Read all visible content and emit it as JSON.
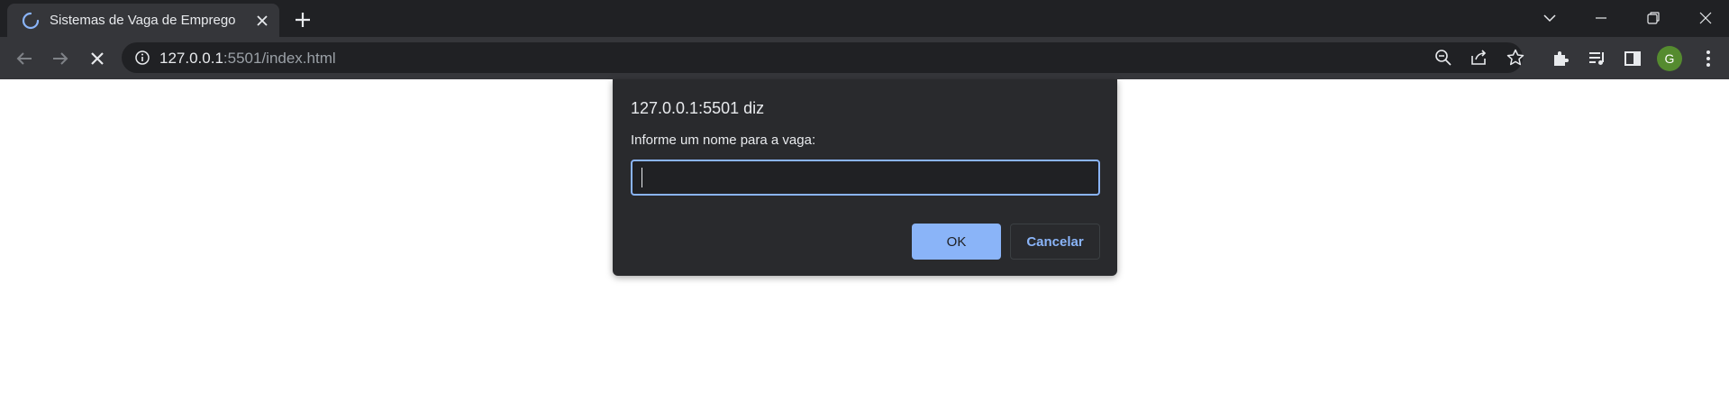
{
  "browser": {
    "tab": {
      "title": "Sistemas de Vaga de Emprego",
      "loading_icon": "spinner-icon",
      "close_icon": "close-icon"
    },
    "new_tab_icon": "plus-icon",
    "window_controls": [
      "tab-search-icon",
      "minimize-icon",
      "restore-icon",
      "close-icon"
    ],
    "toolbar": {
      "back_icon": "back-arrow-icon",
      "forward_icon": "forward-arrow-icon",
      "stop_icon": "stop-icon",
      "url_host": "127.0.0.1",
      "url_rest": ":5501/index.html",
      "omnibox_icons": [
        "zoom-out-icon",
        "share-icon",
        "star-icon"
      ],
      "extension_icons": [
        "puzzle-icon",
        "media-queue-icon",
        "side-panel-icon"
      ],
      "avatar_letter": "G",
      "menu_icon": "kebab-menu-icon"
    }
  },
  "dialog": {
    "title": "127.0.0.1:5501 diz",
    "message": "Informe um nome para a vaga:",
    "input_value": "",
    "ok_label": "OK",
    "cancel_label": "Cancelar"
  },
  "colors": {
    "accent": "#8ab4f8",
    "dialog_bg": "#292a2d",
    "toolbar_bg": "#35363a",
    "tabstrip_bg": "#202124",
    "avatar_bg": "#558b2f"
  }
}
